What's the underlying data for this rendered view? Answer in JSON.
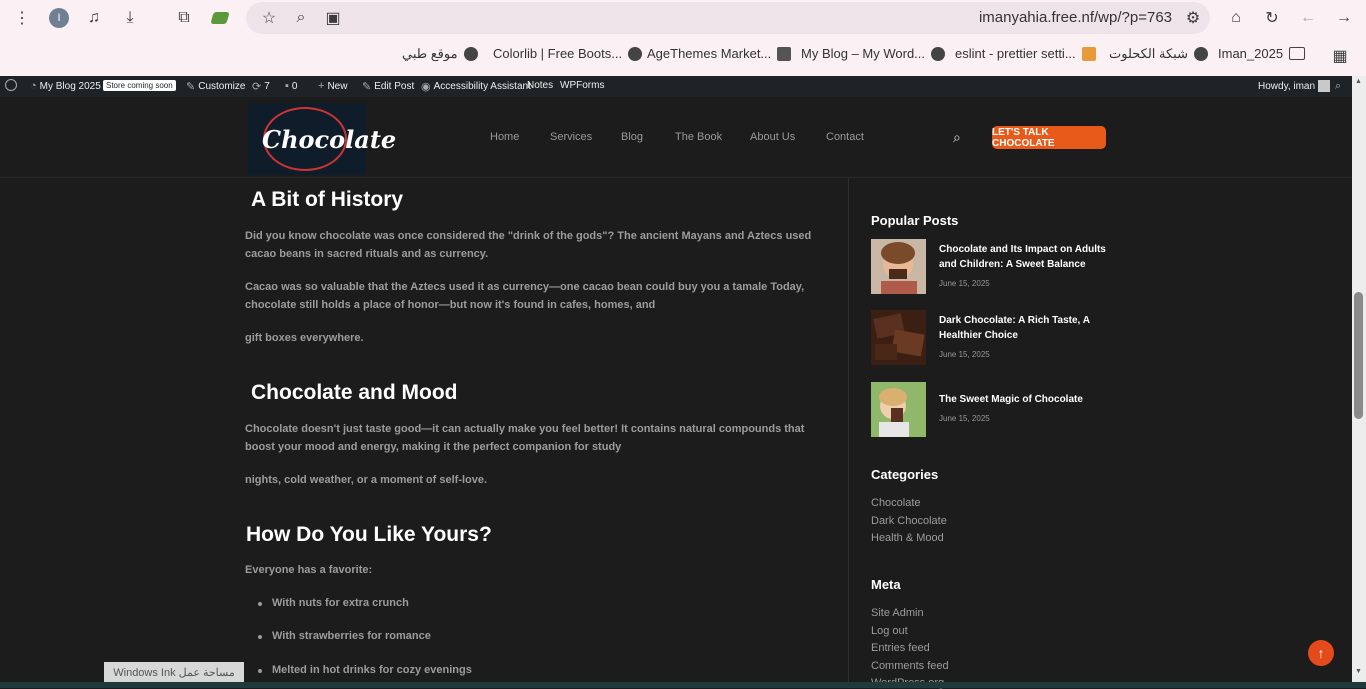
{
  "browser": {
    "url": "imanyahia.free.nf/wp/?p=763",
    "profile_initial": "I",
    "bookmarks": [
      {
        "label": "موقع طبي"
      },
      {
        "label": "Colorlib | Free Boots..."
      },
      {
        "label": "AgeThemes Market..."
      },
      {
        "label": "My Blog – My Word..."
      },
      {
        "label": "eslint - prettier setti..."
      },
      {
        "label": "شبكة الكحلوت"
      },
      {
        "label": "Iman_2025"
      }
    ]
  },
  "admin_bar": {
    "site_name": "My Blog 2025",
    "store_badge": "Store coming soon",
    "customize": "Customize",
    "updates": "7",
    "comments": "0",
    "new": "New",
    "edit_post": "Edit Post",
    "accessibility": "Accessibility Assistant",
    "notes": "Notes",
    "wpforms": "WPForms",
    "howdy": "Howdy, iman"
  },
  "header": {
    "logo_text": "Chocolate",
    "nav": [
      "Home",
      "Services",
      "Blog",
      "The Book",
      "About Us",
      "Contact"
    ],
    "cta": "LET'S TALK CHOCOLATE"
  },
  "article": {
    "h_history": "A Bit of History",
    "p_history_1": "Did you know chocolate was once considered the \"drink of the gods\"? The ancient Mayans and Aztecs used cacao beans in sacred rituals and as currency.",
    "p_history_2": "Cacao was so valuable that the Aztecs used it as currency—one cacao bean could buy you a tamale Today, chocolate still holds a place of honor—but now it's found in cafes, homes, and",
    "p_history_3": "gift boxes everywhere.",
    "h_mood": "Chocolate and Mood",
    "p_mood_1": "Chocolate doesn't just taste good—it can actually make you feel better! It contains natural compounds that boost your mood and energy, making it the perfect companion for study",
    "p_mood_2": "nights, cold weather, or a moment of self-love.",
    "h_yours": "How Do You Like Yours?",
    "p_yours": "Everyone has a favorite:",
    "list": [
      "With nuts for extra crunch",
      "With strawberries for romance",
      "Melted in hot drinks for cozy evenings"
    ]
  },
  "sidebar": {
    "popular_title": "Popular Posts",
    "posts": [
      {
        "title": "Chocolate and Its Impact on Adults and Children: A Sweet Balance",
        "date": "June 15, 2025"
      },
      {
        "title": "Dark Chocolate: A Rich Taste, A Healthier Choice",
        "date": "June 15, 2025"
      },
      {
        "title": "The Sweet Magic of Chocolate",
        "date": "June 15, 2025"
      }
    ],
    "categories_title": "Categories",
    "categories": [
      "Chocolate",
      "Dark Chocolate",
      "Health & Mood"
    ],
    "meta_title": "Meta",
    "meta": [
      "Site Admin",
      "Log out",
      "Entries feed",
      "Comments feed",
      "WordPress.org"
    ]
  },
  "overlay": {
    "windows_ink": "Windows Ink مساحة عمل"
  }
}
